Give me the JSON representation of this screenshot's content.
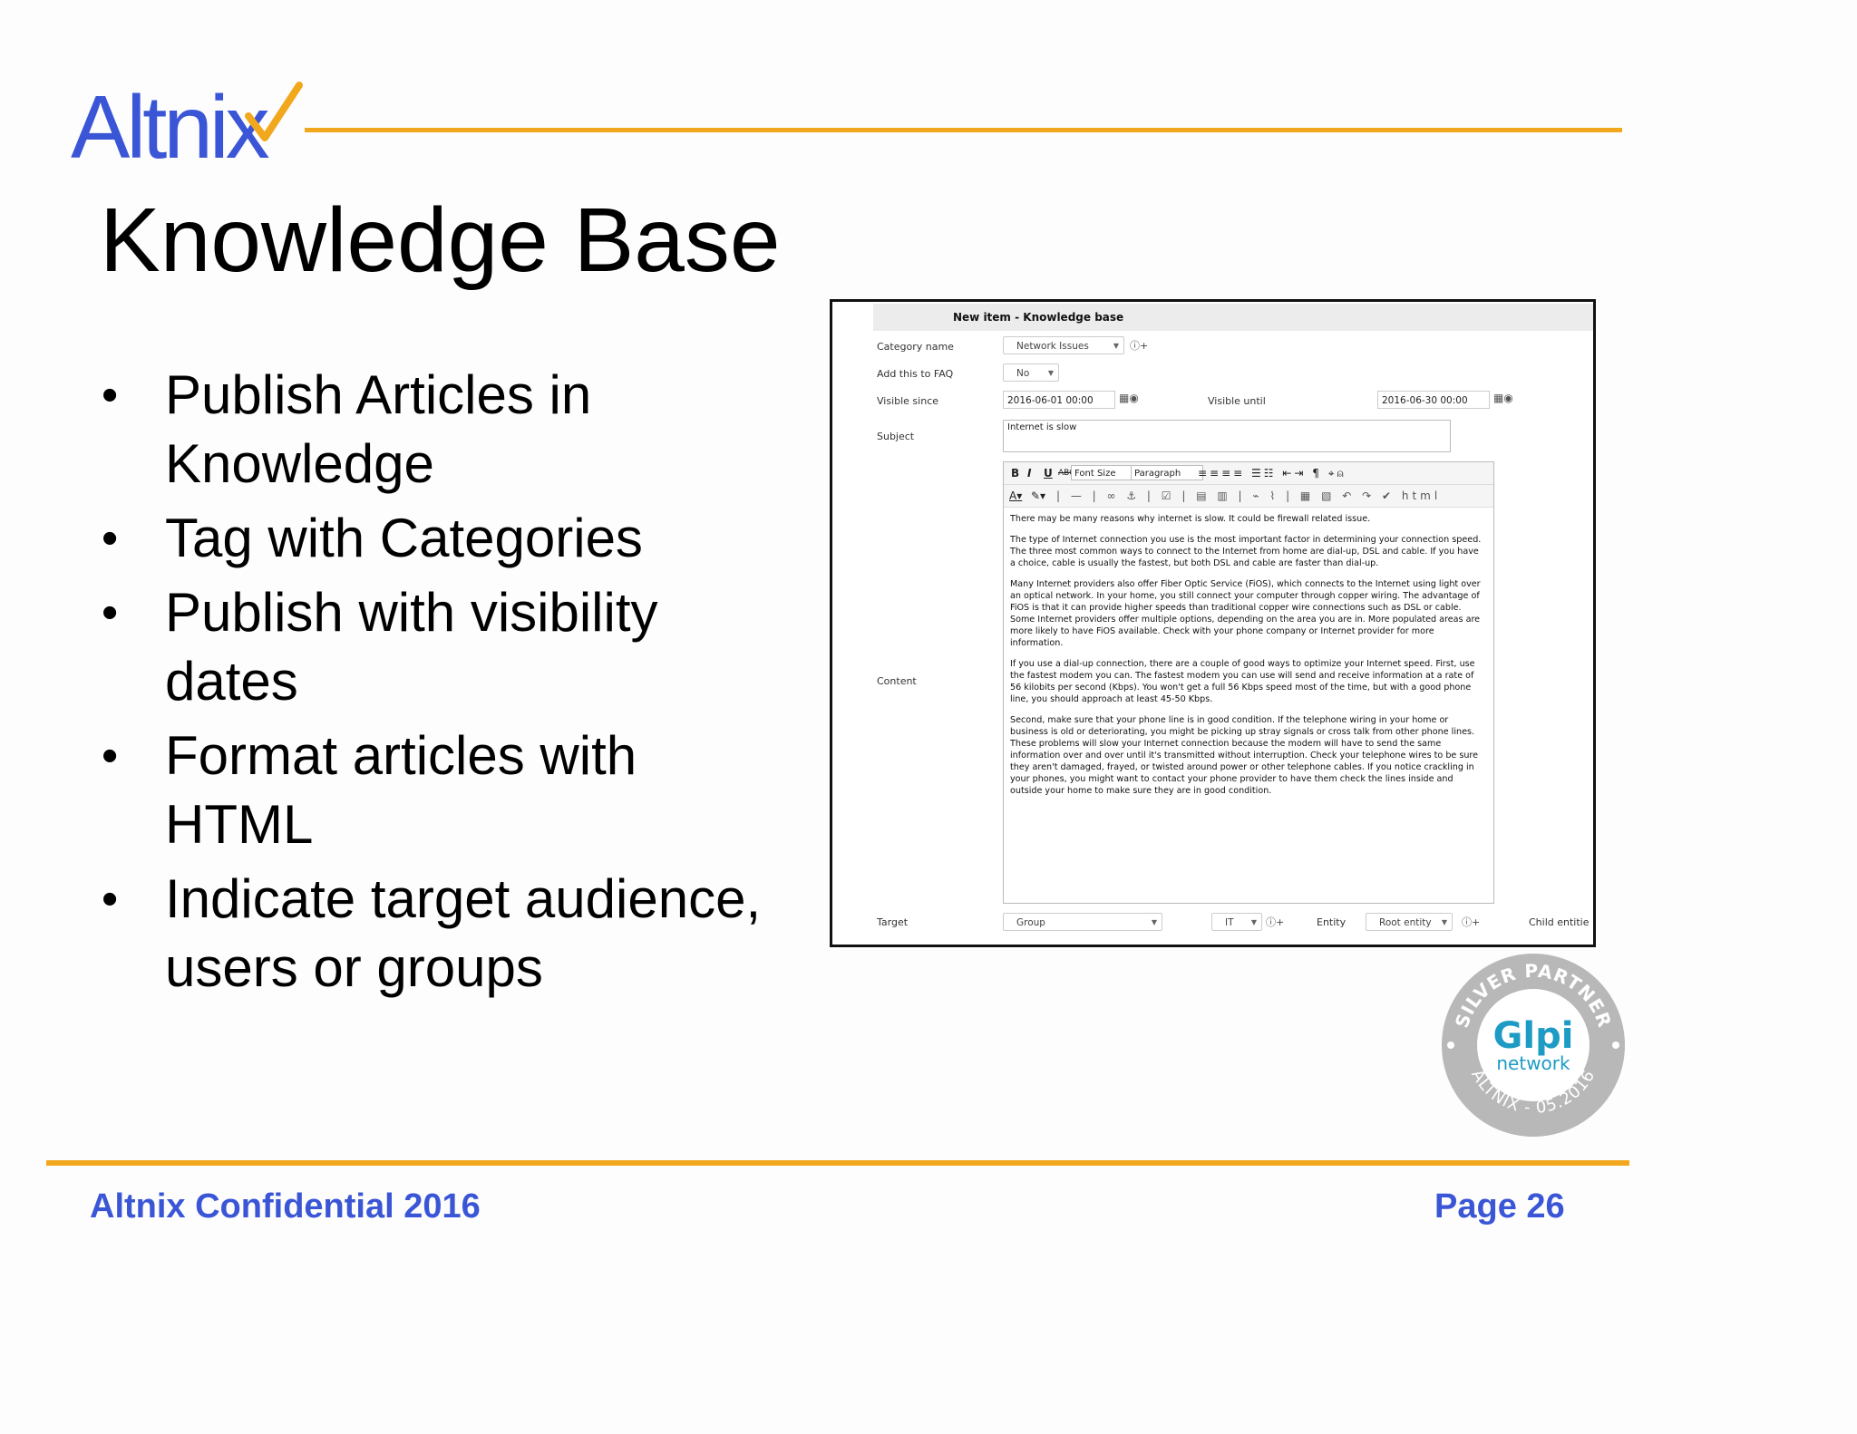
{
  "brand": {
    "logo_text": "Altnix",
    "accent_color": "#f2a81d",
    "brand_blue": "#3a56d6"
  },
  "slide": {
    "title": "Knowledge Base",
    "bullets": [
      {
        "line1": "Publish Articles in",
        "line2": "Knowledge"
      },
      {
        "line1": "Tag with Categories",
        "line2": ""
      },
      {
        "line1": "Publish with visibility",
        "line2": "dates"
      },
      {
        "line1": "Format articles with",
        "line2": "HTML"
      },
      {
        "line1": "Indicate target audience,",
        "line2": "users or groups"
      }
    ]
  },
  "form": {
    "header": "New item - Knowledge base",
    "category_label": "Category name",
    "category_value": "Network Issues",
    "faq_label": "Add this to FAQ",
    "faq_value": "No",
    "visible_since_label": "Visible since",
    "visible_since_value": "2016-06-01 00:00",
    "visible_until_label": "Visible until",
    "visible_until_value": "2016-06-30 00:00",
    "subject_label": "Subject",
    "subject_value": "Internet is slow",
    "content_label": "Content",
    "toolbar": {
      "font_size": "Font Size",
      "paragraph": "Paragraph"
    },
    "content_paragraphs": [
      "There may be many reasons why internet is slow. It could be firewall related issue.",
      "The type of Internet connection you use is the most important factor in determining your connection speed. The three most common ways to connect to the Internet from home are dial-up, DSL and cable. If you have a choice, cable is usually the fastest, but both DSL and cable are faster than dial-up.",
      "Many Internet providers also offer Fiber Optic Service (FiOS), which connects to the Internet using light over an optical network. In your home, you still connect your computer through copper wiring. The advantage of FiOS is that it can provide higher speeds than traditional copper wire connections such as DSL or cable. Some Internet providers offer multiple options, depending on the area you are in. More populated areas are more likely to have FiOS available. Check with your phone company or Internet provider for more information.",
      "If you use a dial-up connection, there are a couple of good ways to optimize your Internet speed. First, use the fastest modem you can. The fastest modem you can use will send and receive information at a rate of 56 kilobits per second (Kbps). You won't get a full 56 Kbps speed most of the time, but with a good phone line, you should approach at least 45-50 Kbps.",
      "Second, make sure that your phone line is in good condition. If the telephone wiring in your home or business is old or deteriorating, you might be picking up stray signals or cross talk from other phone lines. These problems will slow your Internet connection because the modem will have to send the same information over and over until it's transmitted without interruption. Check your telephone wires to be sure they aren't damaged, frayed, or twisted around power or other telephone cables. If you notice crackling in your phones, you might want to contact your phone provider to have them check the lines inside and outside your home to make sure they are in good condition."
    ],
    "target_label": "Target",
    "target_value": "Group",
    "target_sub_value": "IT",
    "entity_label": "Entity",
    "entity_value": "Root entity",
    "child_label": "Child entitie"
  },
  "badge": {
    "top_text": "SILVER PARTNER",
    "brand": "Glpi",
    "sub": "network",
    "bottom_text": "ALTNIX - 05.2016"
  },
  "footer": {
    "left": "Altnix Confidential 2016",
    "right": "Page 26"
  }
}
